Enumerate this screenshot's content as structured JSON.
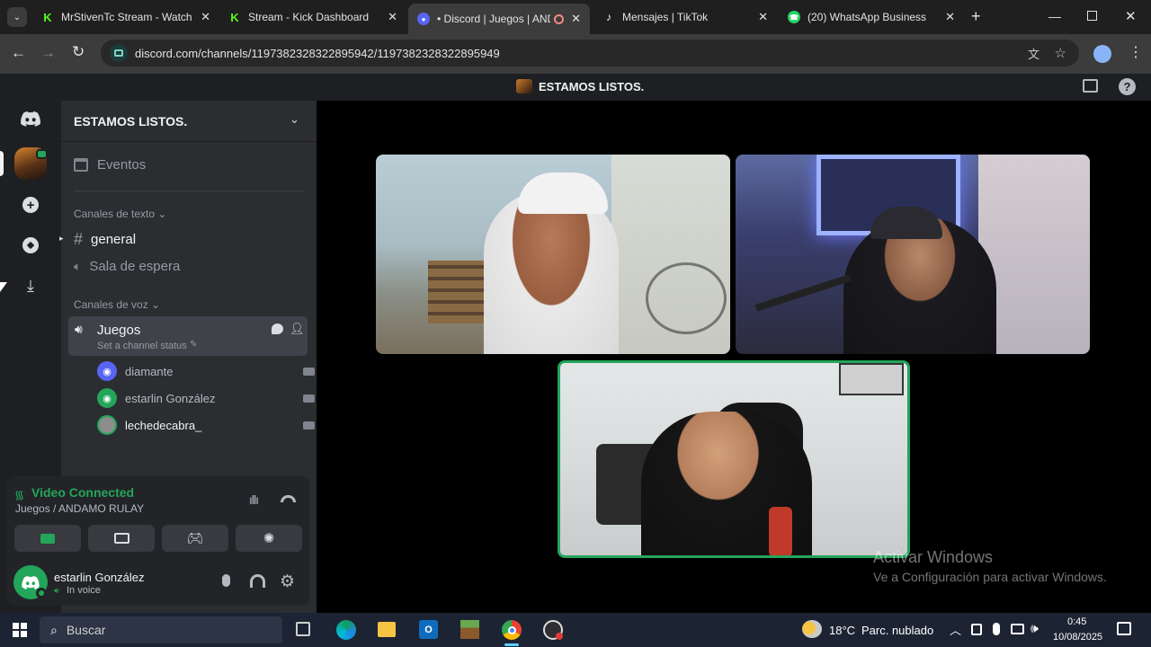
{
  "browser": {
    "tabs": [
      {
        "label": "MrStivenTc Stream - Watch l",
        "fav": "K",
        "fav_color": "#53fc18"
      },
      {
        "label": "Stream - Kick Dashboard",
        "fav": "K",
        "fav_color": "#53fc18"
      },
      {
        "label": "• Discord | Juegos | AND",
        "fav": "●",
        "fav_color": "#5865f2"
      },
      {
        "label": "Mensajes | TikTok",
        "fav": "♪",
        "fav_color": "#ffffff"
      },
      {
        "label": "(20) WhatsApp Business",
        "fav": "☎",
        "fav_color": "#25d366"
      }
    ],
    "url": "discord.com/channels/1197382328322895942/1197382328322895949"
  },
  "discord": {
    "window_title": "ESTAMOS LISTOS.",
    "server_name": "ESTAMOS LISTOS.",
    "events_label": "Eventos",
    "text_section": "Canales de texto",
    "text_channels": [
      "general",
      "Sala de espera"
    ],
    "voice_section": "Canales de voz",
    "voice_channel": "Juegos",
    "channel_status": "Set a channel status",
    "members": [
      "diamante",
      "estarlin González",
      "lechedecabra_"
    ],
    "connection_status": "Video Connected",
    "connection_channel": "Juegos / ANDAMO RULAY",
    "user_name": "estarlin González",
    "user_status": "In voice"
  },
  "watermark": {
    "title": "Activar Windows",
    "subtitle": "Ve a Configuración para activar Windows."
  },
  "taskbar": {
    "search_placeholder": "Buscar",
    "weather_temp": "18°C",
    "weather_text": "Parc. nublado",
    "time": "0:45",
    "date": "10/08/2025"
  },
  "colors": {
    "accent": "#5865f2",
    "connected_green": "#23a55a",
    "speaking_ring": "#23a55a"
  }
}
